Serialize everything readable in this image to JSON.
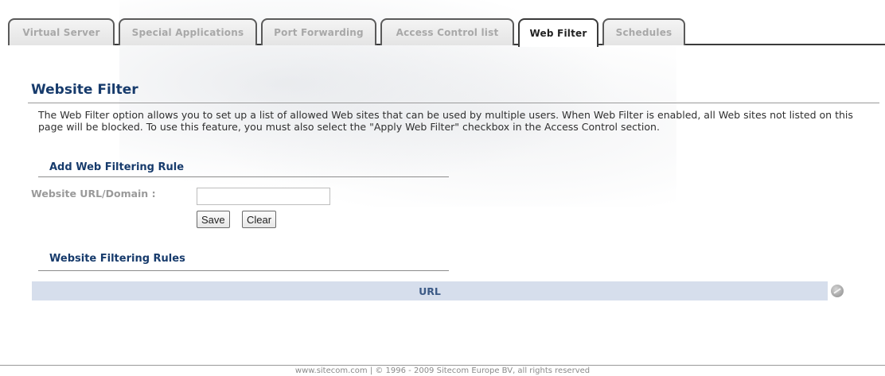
{
  "tabs": [
    {
      "label": "Virtual Server",
      "active": false
    },
    {
      "label": "Special Applications",
      "active": false
    },
    {
      "label": "Port Forwarding",
      "active": false
    },
    {
      "label": "Access Control list",
      "active": false
    },
    {
      "label": "Web Filter",
      "active": true
    },
    {
      "label": "Schedules",
      "active": false
    }
  ],
  "page": {
    "title": "Website Filter",
    "description": "The Web Filter option allows you to set up a list of allowed Web sites that can be used by multiple users. When Web Filter is enabled, all Web sites not listed on this page will be blocked. To use this feature, you must also select the \"Apply Web Filter\" checkbox in the Access Control section."
  },
  "add_rule": {
    "section_title": "Add Web Filtering Rule",
    "field_label": "Website URL/Domain :",
    "field_value": "",
    "save_label": "Save",
    "clear_label": "Clear"
  },
  "rules": {
    "section_title": "Website Filtering Rules",
    "columns": [
      "URL"
    ],
    "delete_icon": "delete-icon"
  },
  "footer": {
    "text": "www.sitecom.com | © 1996 - 2009 Sitecom Europe BV, all rights reserved"
  },
  "colors": {
    "title": "#173b6c",
    "table_header_bg": "#d6deec",
    "table_header_text": "#3c5a86"
  }
}
